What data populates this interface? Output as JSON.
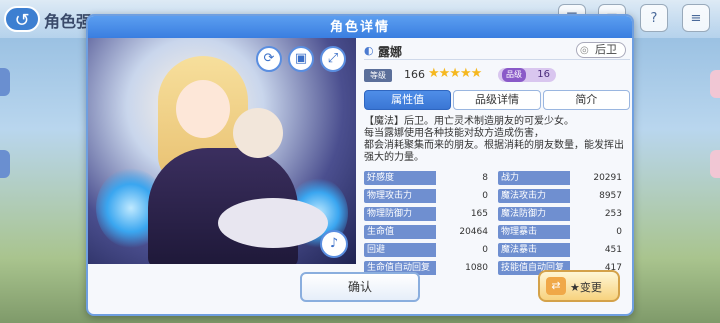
{
  "background": {
    "screen_title": "角色强",
    "back_icon": "back-arrow-icon"
  },
  "dialog": {
    "title": "角色详情",
    "portrait_buttons": [
      {
        "name": "refresh-icon",
        "glyph": "⟳"
      },
      {
        "name": "card-icon",
        "glyph": "▣"
      },
      {
        "name": "expand-icon",
        "glyph": "⤢"
      }
    ],
    "voice_icon": "♪",
    "character": {
      "name": "露娜",
      "role": "后卫",
      "level_label": "等级",
      "level": "166",
      "stars": "★★★★★",
      "rank_label": "品级",
      "rank": "16"
    },
    "tabs": [
      {
        "label": "属性值",
        "active": true
      },
      {
        "label": "品级详情",
        "active": false
      },
      {
        "label": "简介",
        "active": false
      }
    ],
    "description": [
      "【魔法】后卫。用亡灵术制造朋友的可爱少女。",
      "每当露娜使用各种技能对敌方造成伤害，",
      "都会消耗聚集而来的朋友。根据消耗的朋友数量，能发挥出",
      "强大的力量。"
    ],
    "stats_left": [
      {
        "label": "好感度",
        "value": "8"
      },
      {
        "label": "物理攻击力",
        "value": "0"
      },
      {
        "label": "物理防御力",
        "value": "165"
      },
      {
        "label": "生命值",
        "value": "20464"
      },
      {
        "label": "回避",
        "value": "0"
      },
      {
        "label": "生命值自动回复",
        "value": "1080"
      }
    ],
    "stats_right": [
      {
        "label": "战力",
        "value": "20291"
      },
      {
        "label": "魔法攻击力",
        "value": "8957"
      },
      {
        "label": "魔法防御力",
        "value": "253"
      },
      {
        "label": "物理暴击",
        "value": "0"
      },
      {
        "label": "魔法暴击",
        "value": "451"
      },
      {
        "label": "技能值自动回复",
        "value": "417"
      }
    ],
    "confirm_label": "确认",
    "change_label": "★变更"
  }
}
